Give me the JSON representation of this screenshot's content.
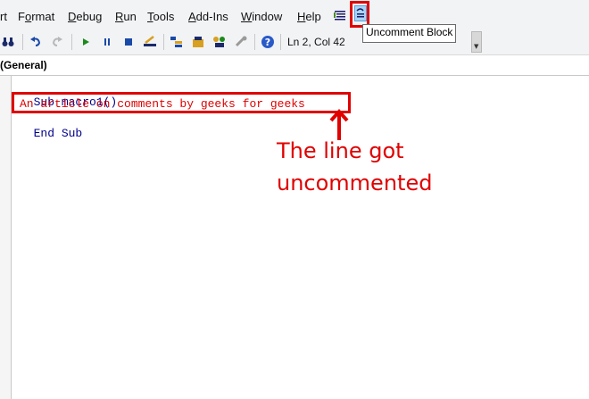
{
  "menubar": {
    "items": [
      {
        "label": "rt",
        "underline": ""
      },
      {
        "label": "Format",
        "underline": "o"
      },
      {
        "label": "Debug",
        "underline": "D"
      },
      {
        "label": "Run",
        "underline": "R"
      },
      {
        "label": "Tools",
        "underline": "T"
      },
      {
        "label": "Add-Ins",
        "underline": "A"
      },
      {
        "label": "Window",
        "underline": "W"
      },
      {
        "label": "Help",
        "underline": "H"
      }
    ]
  },
  "toolbar": {
    "icons": [
      "binoculars-icon",
      "undo-icon",
      "redo-icon",
      "run-icon",
      "break-icon",
      "reset-icon",
      "design-mode-icon",
      "project-explorer-icon",
      "properties-icon",
      "object-browser-icon",
      "toolbox-icon",
      "help-icon"
    ],
    "cursor_position": "Ln 2, Col 42",
    "comment_block_icon": "comment-block-icon",
    "uncomment_block_icon": "uncomment-block-icon",
    "tooltip": "Uncomment Block"
  },
  "object_selector": "(General)",
  "code_lines": [
    {
      "keyword1": "Sub",
      "rest": " macro1()"
    },
    {
      "text": "An article on comments by geeks for geeks"
    },
    {
      "keyword1": "End",
      "keyword2": "Sub"
    }
  ],
  "annotation": {
    "line1": "The line got",
    "line2": "uncommented"
  },
  "colors": {
    "annotation": "#e00000",
    "keyword": "#00008b",
    "highlight": "#e00000"
  }
}
